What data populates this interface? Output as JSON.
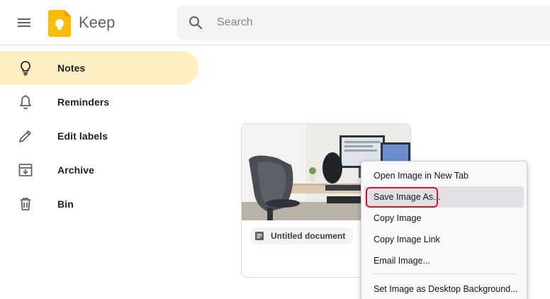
{
  "header": {
    "menu_icon": "hamburger-menu-icon",
    "logo_icon": "keep-logo-icon",
    "app_title": "Keep",
    "search_placeholder": "Search"
  },
  "sidebar": {
    "items": [
      {
        "label": "Notes",
        "icon": "lightbulb-icon",
        "active": true
      },
      {
        "label": "Reminders",
        "icon": "bell-icon",
        "active": false
      },
      {
        "label": "Edit labels",
        "icon": "pencil-icon",
        "active": false
      },
      {
        "label": "Archive",
        "icon": "archive-icon",
        "active": false
      },
      {
        "label": "Bin",
        "icon": "trash-icon",
        "active": false
      }
    ]
  },
  "note": {
    "attachment_label": "Untitled document",
    "attachment_icon": "document-icon"
  },
  "context_menu": {
    "items": [
      {
        "label": "Open Image in New Tab"
      },
      {
        "label": "Save Image As...",
        "hovered": true,
        "highlighted": true
      },
      {
        "label": "Copy Image"
      },
      {
        "label": "Copy Image Link"
      },
      {
        "label": "Email Image..."
      },
      {
        "label": "Set Image as Desktop Background..."
      }
    ]
  },
  "colors": {
    "active_nav": "#feefc3",
    "keep_yellow": "#fbbc04",
    "highlight_red": "#d4191f"
  }
}
